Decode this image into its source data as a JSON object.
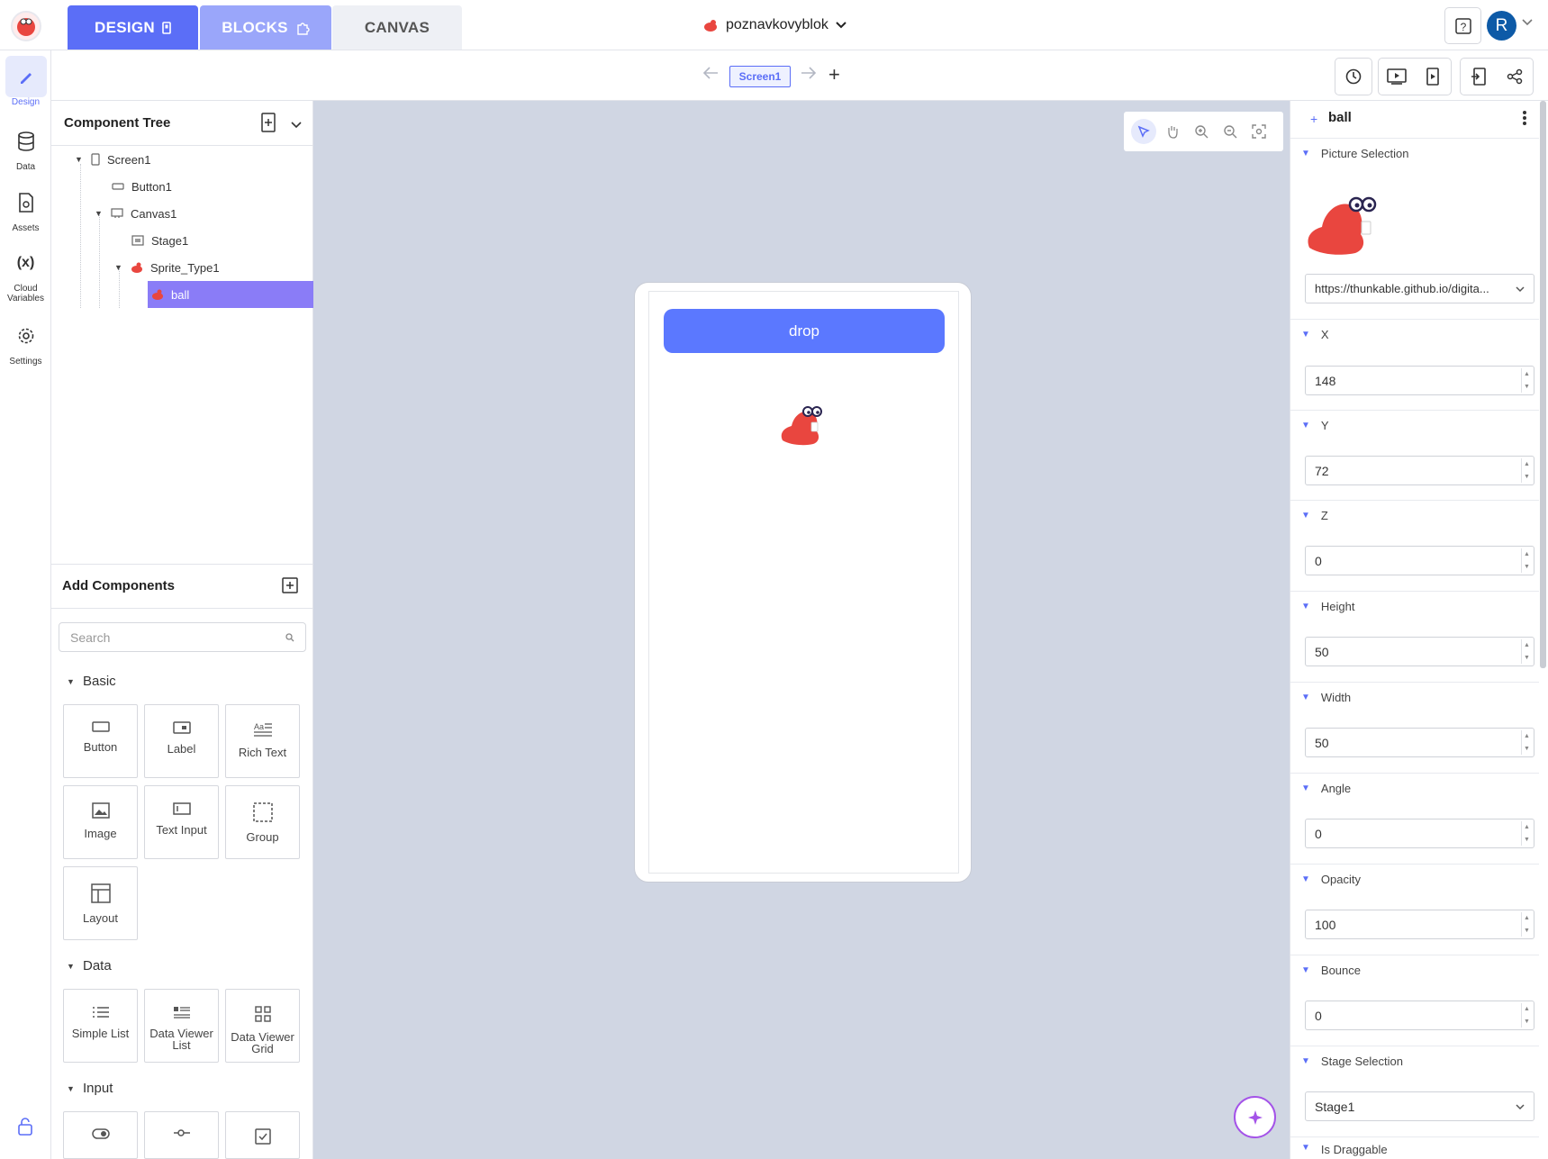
{
  "topbar": {
    "tabs": [
      {
        "label": "DESIGN"
      },
      {
        "label": "BLOCKS"
      },
      {
        "label": "CANVAS"
      }
    ],
    "project_name": "poznavkovyblok",
    "avatar_letter": "R",
    "help_icon": "question-icon"
  },
  "rail": {
    "items": [
      {
        "label": "Design",
        "icon": "brush-icon"
      },
      {
        "label": "Data",
        "icon": "database-icon"
      },
      {
        "label": "Assets",
        "icon": "file-icon"
      },
      {
        "label": "Cloud Variables",
        "label_line1": "Cloud",
        "label_line2": "Variables",
        "icon": "variable-icon"
      },
      {
        "label": "Settings",
        "icon": "gear-icon"
      }
    ]
  },
  "toolbar": {
    "screen_chip": "Screen1",
    "add_label": "+"
  },
  "tree": {
    "title": "Component Tree",
    "rows": [
      {
        "label": "Screen1"
      },
      {
        "label": "Button1"
      },
      {
        "label": "Canvas1"
      },
      {
        "label": "Stage1"
      },
      {
        "label": "Sprite_Type1"
      },
      {
        "label": "ball"
      }
    ]
  },
  "add_components": {
    "title": "Add Components",
    "search_placeholder": "Search",
    "sections": {
      "basic": {
        "title": "Basic",
        "items": [
          "Button",
          "Label",
          "Rich Text",
          "Image",
          "Text Input",
          "Group",
          "Layout"
        ]
      },
      "data": {
        "title": "Data",
        "items": [
          "Simple List",
          "Data Viewer List",
          "Data Viewer Grid"
        ]
      },
      "input": {
        "title": "Input"
      }
    }
  },
  "canvas": {
    "drop_label": "drop"
  },
  "props": {
    "component_name": "ball",
    "picture_selection_label": "Picture Selection",
    "picture_url": "https://thunkable.github.io/digita...",
    "fields": [
      {
        "label": "X",
        "value": "148"
      },
      {
        "label": "Y",
        "value": "72"
      },
      {
        "label": "Z",
        "value": "0"
      },
      {
        "label": "Height",
        "value": "50"
      },
      {
        "label": "Width",
        "value": "50"
      },
      {
        "label": "Angle",
        "value": "0"
      },
      {
        "label": "Opacity",
        "value": "100"
      },
      {
        "label": "Bounce",
        "value": "0"
      }
    ],
    "stage_selection_label": "Stage Selection",
    "stage_value": "Stage1",
    "is_draggable_label": "Is Draggable"
  },
  "colors": {
    "accent": "#5b6ef7",
    "tab_blocks": "#9aa6fa",
    "canvas_bg": "#d0d6e3",
    "sprite_red": "#e9463f",
    "selected_row": "#8a7cf7"
  }
}
